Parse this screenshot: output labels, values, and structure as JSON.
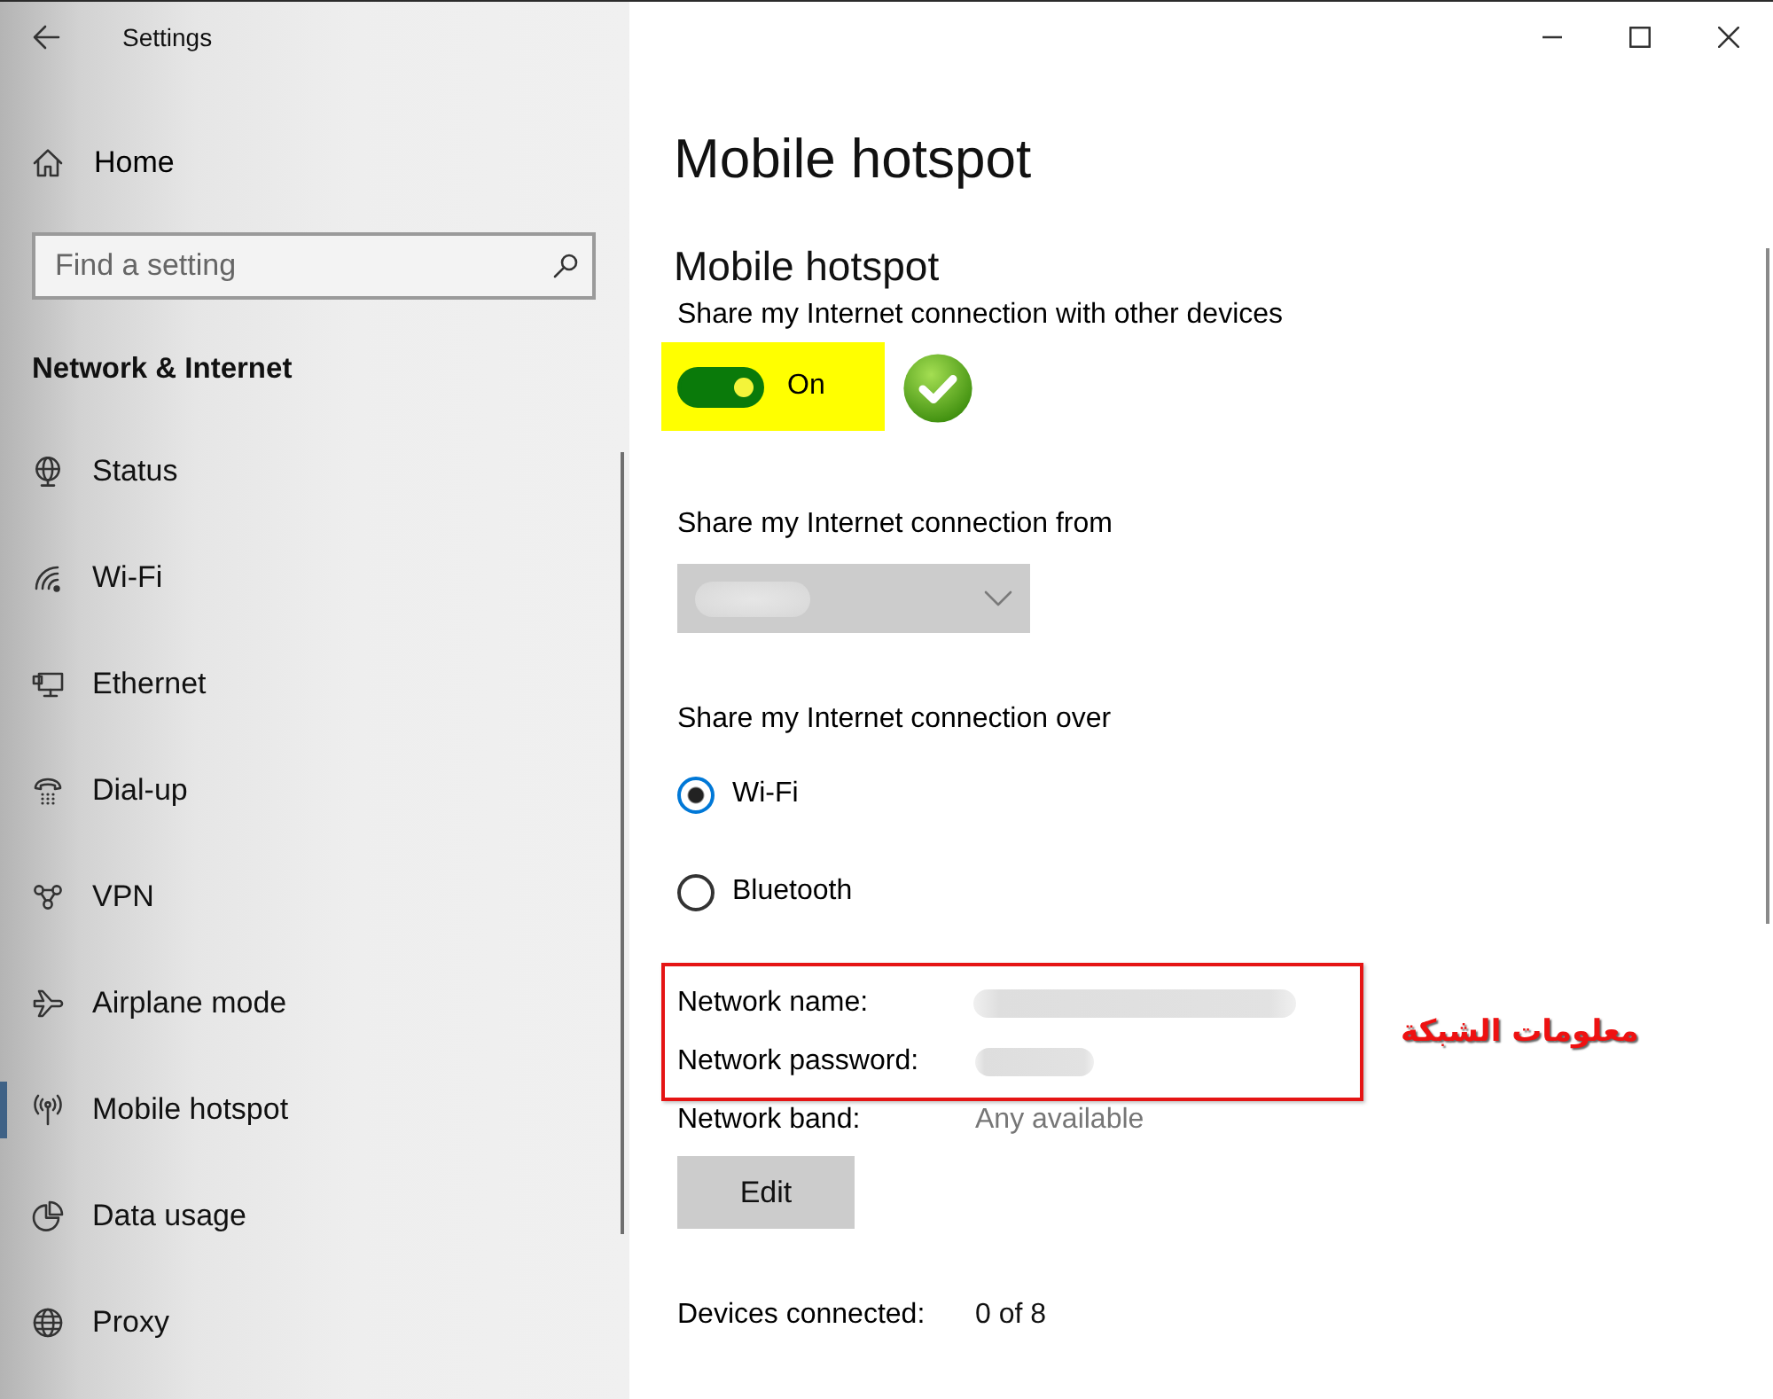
{
  "window": {
    "title": "Settings"
  },
  "sidebar": {
    "home": "Home",
    "search": {
      "placeholder": "Find a setting"
    },
    "section": "Network & Internet",
    "items": [
      {
        "label": "Status",
        "selected": false
      },
      {
        "label": "Wi-Fi",
        "selected": false
      },
      {
        "label": "Ethernet",
        "selected": false
      },
      {
        "label": "Dial-up",
        "selected": false
      },
      {
        "label": "VPN",
        "selected": false
      },
      {
        "label": "Airplane mode",
        "selected": false
      },
      {
        "label": "Mobile hotspot",
        "selected": true
      },
      {
        "label": "Data usage",
        "selected": false
      },
      {
        "label": "Proxy",
        "selected": false
      }
    ]
  },
  "page": {
    "title": "Mobile hotspot",
    "hotspot": {
      "heading": "Mobile hotspot",
      "description": "Share my Internet connection with other devices",
      "toggle": {
        "on": true,
        "label": "On",
        "highlighted": true
      },
      "check_mark": true
    },
    "share_from": {
      "label": "Share my Internet connection from",
      "dropdown": {
        "disabled": true
      }
    },
    "share_over": {
      "label": "Share my Internet connection over",
      "options": [
        {
          "label": "Wi-Fi",
          "selected": true
        },
        {
          "label": "Bluetooth",
          "selected": false
        }
      ]
    },
    "network": {
      "frame": {
        "annotation": "معلومات الشبكة",
        "rows": [
          {
            "label": "Network name:",
            "kind": "blurred"
          },
          {
            "label": "Network password:",
            "kind": "blurred"
          }
        ]
      },
      "rows": [
        {
          "label": "Network band:",
          "kind": "text",
          "value": "Any available"
        }
      ]
    },
    "edit_button": "Edit",
    "devices": {
      "label": "Devices connected:",
      "value": "0 of 8"
    }
  }
}
